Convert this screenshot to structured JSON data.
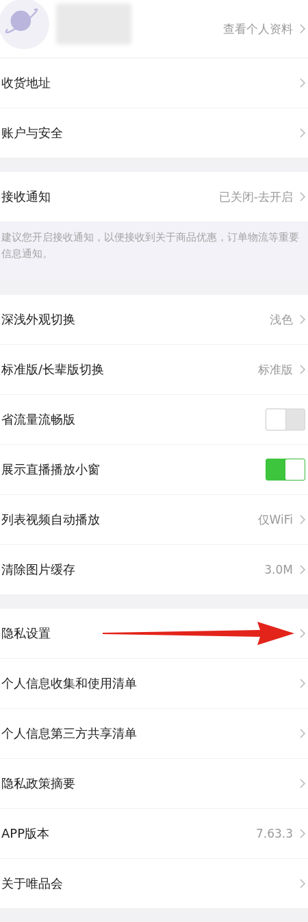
{
  "profile": {
    "link": "查看个人资料"
  },
  "sections": [
    {
      "rows": [
        {
          "kind": "link",
          "label": "收货地址"
        },
        {
          "kind": "link",
          "label": "账户与安全"
        }
      ]
    },
    {
      "rows": [
        {
          "kind": "link",
          "label": "接收通知",
          "value": "已关闭-去开启"
        },
        {
          "kind": "hint",
          "text": "建议您开启接收通知，以便接收到关于商品优惠，订单物流等重要信息通知。"
        }
      ]
    },
    {
      "rows": [
        {
          "kind": "link",
          "label": "深浅外观切换",
          "value": "浅色"
        },
        {
          "kind": "link",
          "label": "标准版/长辈版切换",
          "value": "标准版"
        },
        {
          "kind": "toggle",
          "label": "省流量流畅版",
          "on": false
        },
        {
          "kind": "toggle",
          "label": "展示直播播放小窗",
          "on": true
        },
        {
          "kind": "link",
          "label": "列表视频自动播放",
          "value": "仅WiFi"
        },
        {
          "kind": "link",
          "label": "清除图片缓存",
          "value": "3.0M"
        }
      ]
    },
    {
      "rows": [
        {
          "kind": "link",
          "label": "隐私设置",
          "arrow": true
        },
        {
          "kind": "link",
          "label": "个人信息收集和使用清单"
        },
        {
          "kind": "link",
          "label": "个人信息第三方共享清单"
        },
        {
          "kind": "link",
          "label": "隐私政策摘要"
        },
        {
          "kind": "link",
          "label": "APP版本",
          "value": "7.63.3"
        },
        {
          "kind": "link",
          "label": "关于唯品会"
        }
      ]
    }
  ]
}
